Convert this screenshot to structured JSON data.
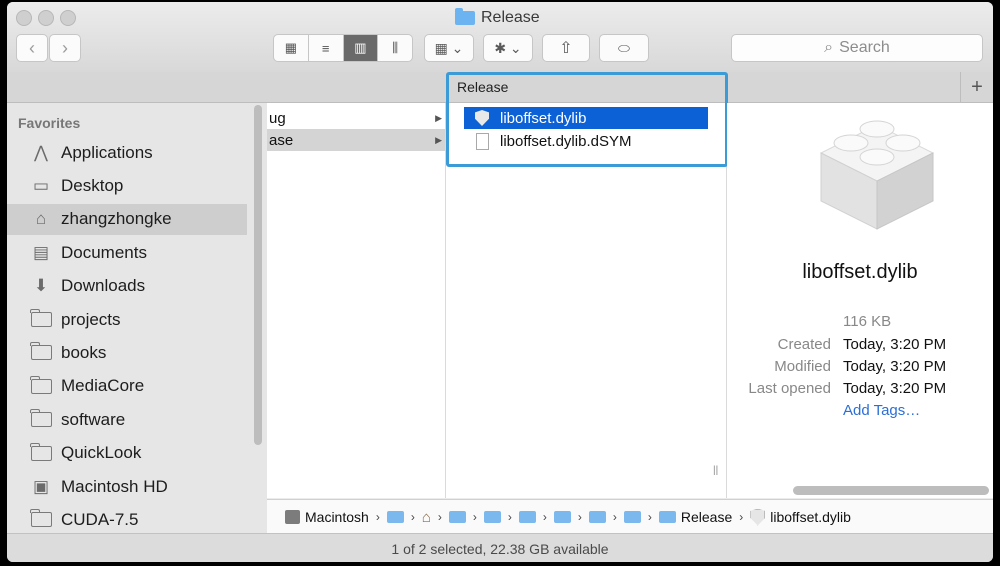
{
  "window": {
    "title": "Release"
  },
  "toolbar": {
    "back_label": "‹",
    "forward_label": "›",
    "view_icons": [
      "▦",
      "≡",
      "▥",
      "⫼"
    ],
    "arrange_label": "▦ ⌄",
    "action_label": "✱ ⌄",
    "share_label": "⇧",
    "tag_label": "⬭",
    "search_placeholder": "Search",
    "search_icon": "⌕"
  },
  "header": {
    "column_title": "Release",
    "add_label": "+"
  },
  "sidebar": {
    "section_title": "Favorites",
    "items": [
      {
        "label": "Applications",
        "icon": "applications-icon",
        "glyph": "⋀"
      },
      {
        "label": "Desktop",
        "icon": "desktop-icon",
        "glyph": "▭"
      },
      {
        "label": "zhangzhongke",
        "icon": "home-icon",
        "glyph": "⌂"
      },
      {
        "label": "Documents",
        "icon": "documents-icon",
        "glyph": "▤"
      },
      {
        "label": "Downloads",
        "icon": "downloads-icon",
        "glyph": "⬇"
      },
      {
        "label": "projects",
        "icon": "folder-icon",
        "glyph": ""
      },
      {
        "label": "books",
        "icon": "folder-icon",
        "glyph": ""
      },
      {
        "label": "MediaCore",
        "icon": "folder-icon",
        "glyph": ""
      },
      {
        "label": "software",
        "icon": "folder-icon",
        "glyph": ""
      },
      {
        "label": "QuickLook",
        "icon": "folder-icon",
        "glyph": ""
      },
      {
        "label": "Macintosh HD",
        "icon": "hard-drive-icon",
        "glyph": "▣"
      },
      {
        "label": "CUDA-7.5",
        "icon": "folder-icon",
        "glyph": ""
      }
    ]
  },
  "column1": {
    "rows": [
      {
        "label": "ug"
      },
      {
        "label": "ase"
      }
    ]
  },
  "column2": {
    "rows": [
      {
        "label": "liboffset.dylib"
      },
      {
        "label": "liboffset.dylib.dSYM"
      }
    ]
  },
  "preview": {
    "name": "liboffset.dylib",
    "size": "116 KB",
    "created_label": "Created",
    "created_value": "Today, 3:20 PM",
    "modified_label": "Modified",
    "modified_value": "Today, 3:20 PM",
    "opened_label": "Last opened",
    "opened_value": "Today, 3:20 PM",
    "tags_link": "Add Tags…"
  },
  "pathbar": {
    "root": "Macintosh",
    "release": "Release",
    "file": "liboffset.dylib"
  },
  "status": {
    "text": "1 of 2 selected, 22.38 GB available"
  },
  "colors": {
    "selection": "#0c61d6",
    "highlight_border": "#3b9bd6",
    "folder": "#6cb3f2"
  }
}
